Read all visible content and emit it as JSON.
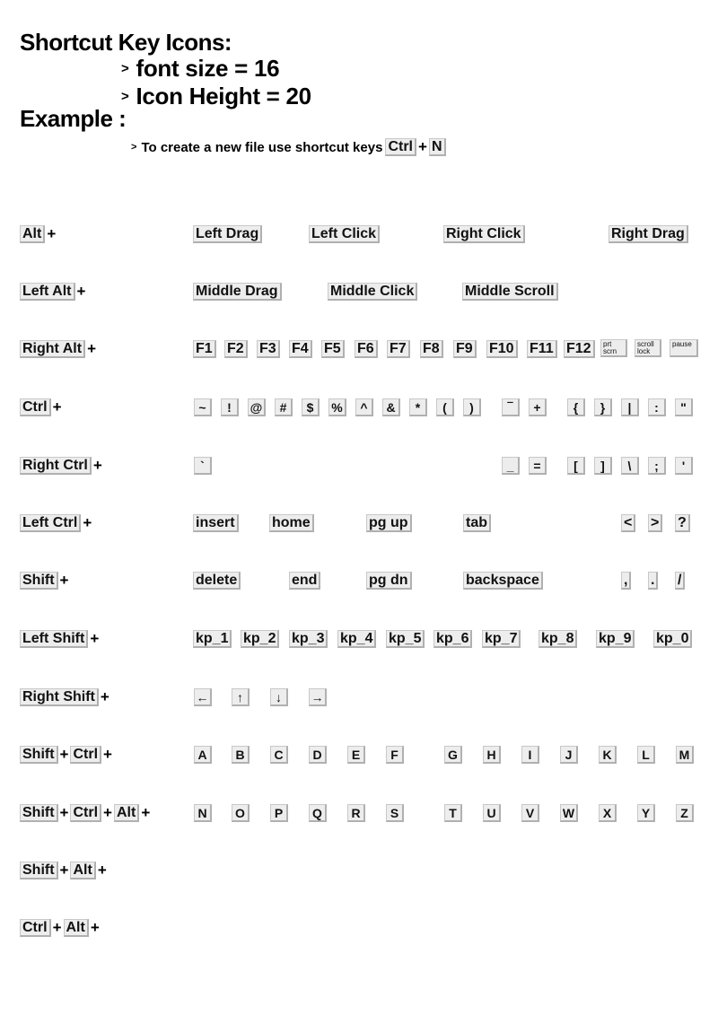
{
  "header": {
    "title": "Shortcut Key Icons:",
    "bullets": [
      {
        "marker": ">",
        "text": "font size = 16"
      },
      {
        "marker": ">",
        "text": "Icon Height = 20"
      }
    ],
    "example_title": "Example :",
    "example": {
      "marker": ">",
      "text": "To create a new file use shortcut keys",
      "keys": [
        "Ctrl",
        "N"
      ],
      "plus": "+"
    }
  },
  "plus": "+",
  "rows": [
    {
      "modifiers": [
        "Alt"
      ],
      "keys": [
        "Left Drag",
        "Left Click",
        "Right Click",
        "Right Drag"
      ]
    },
    {
      "modifiers": [
        "Left Alt"
      ],
      "keys": [
        "Middle Drag",
        "Middle Click",
        "Middle Scroll"
      ]
    },
    {
      "modifiers": [
        "Right Alt"
      ],
      "keys": [
        "F1",
        "F2",
        "F3",
        "F4",
        "F5",
        "F6",
        "F7",
        "F8",
        "F9",
        "F10",
        "F11",
        "F12"
      ],
      "small_keys": [
        "prt scrn",
        "scroll lock",
        "pause"
      ]
    },
    {
      "modifiers": [
        "Ctrl"
      ],
      "keys": [
        "~",
        "!",
        "@",
        "#",
        "$",
        "%",
        "^",
        "&",
        "*",
        "(",
        ")",
        "‾",
        "+",
        "{",
        "}",
        "|",
        ":",
        "\""
      ]
    },
    {
      "modifiers": [
        "Right Ctrl"
      ],
      "keys": [
        "`",
        "_",
        "=",
        "[",
        "]",
        "\\",
        ";",
        "'"
      ]
    },
    {
      "modifiers": [
        "Left Ctrl"
      ],
      "keys": [
        "insert",
        "home",
        "pg up",
        "tab",
        "<",
        ">",
        "?"
      ]
    },
    {
      "modifiers": [
        "Shift"
      ],
      "keys": [
        "delete",
        "end",
        "pg dn",
        "backspace",
        ",",
        ".",
        "/"
      ]
    },
    {
      "modifiers": [
        "Left Shift"
      ],
      "keys": [
        "kp_1",
        "kp_2",
        "kp_3",
        "kp_4",
        "kp_5",
        "kp_6",
        "kp_7",
        "kp_8",
        "kp_9",
        "kp_0"
      ]
    },
    {
      "modifiers": [
        "Right Shift"
      ],
      "keys": [
        "←",
        "↑",
        "↓",
        "→"
      ]
    },
    {
      "modifiers": [
        "Shift",
        "Ctrl"
      ],
      "keys": [
        "A",
        "B",
        "C",
        "D",
        "E",
        "F",
        "G",
        "H",
        "I",
        "J",
        "K",
        "L",
        "M"
      ]
    },
    {
      "modifiers": [
        "Shift",
        "Ctrl",
        "Alt"
      ],
      "keys": [
        "N",
        "O",
        "P",
        "Q",
        "R",
        "S",
        "T",
        "U",
        "V",
        "W",
        "X",
        "Y",
        "Z"
      ]
    },
    {
      "modifiers": [
        "Shift",
        "Alt"
      ],
      "keys": []
    },
    {
      "modifiers": [
        "Ctrl",
        "Alt"
      ],
      "keys": []
    }
  ],
  "colors": {
    "key_bg": "#ededed",
    "key_border": "#b0b0b0",
    "text": "#000000"
  }
}
